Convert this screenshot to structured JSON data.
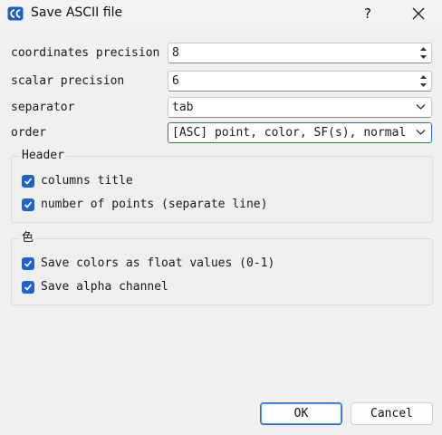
{
  "window": {
    "title": "Save ASCII file",
    "help_label": "?",
    "accent_color": "#1f63c9"
  },
  "fields": {
    "coordinates_precision": {
      "label": "coordinates precision",
      "value": "8"
    },
    "scalar_precision": {
      "label": "scalar precision",
      "value": "6"
    },
    "separator": {
      "label": "separator",
      "value": "tab"
    },
    "order": {
      "label": "order",
      "value": "[ASC] point, color, SF(s), normal"
    }
  },
  "header_group": {
    "title": "Header",
    "options": [
      {
        "label": "columns title",
        "checked": true
      },
      {
        "label": "number of points (separate line)",
        "checked": true
      }
    ]
  },
  "color_group": {
    "title": "色",
    "options": [
      {
        "label": "Save colors as float values (0-1)",
        "checked": true
      },
      {
        "label": "Save alpha channel",
        "checked": true
      }
    ]
  },
  "buttons": {
    "ok": "OK",
    "cancel": "Cancel"
  },
  "icons": {
    "app": "cloudcompare-logo-icon",
    "close": "close-icon",
    "check": "checkmark-icon",
    "spin": "spin-arrows-icon",
    "dropdown": "chevron-down-icon"
  }
}
